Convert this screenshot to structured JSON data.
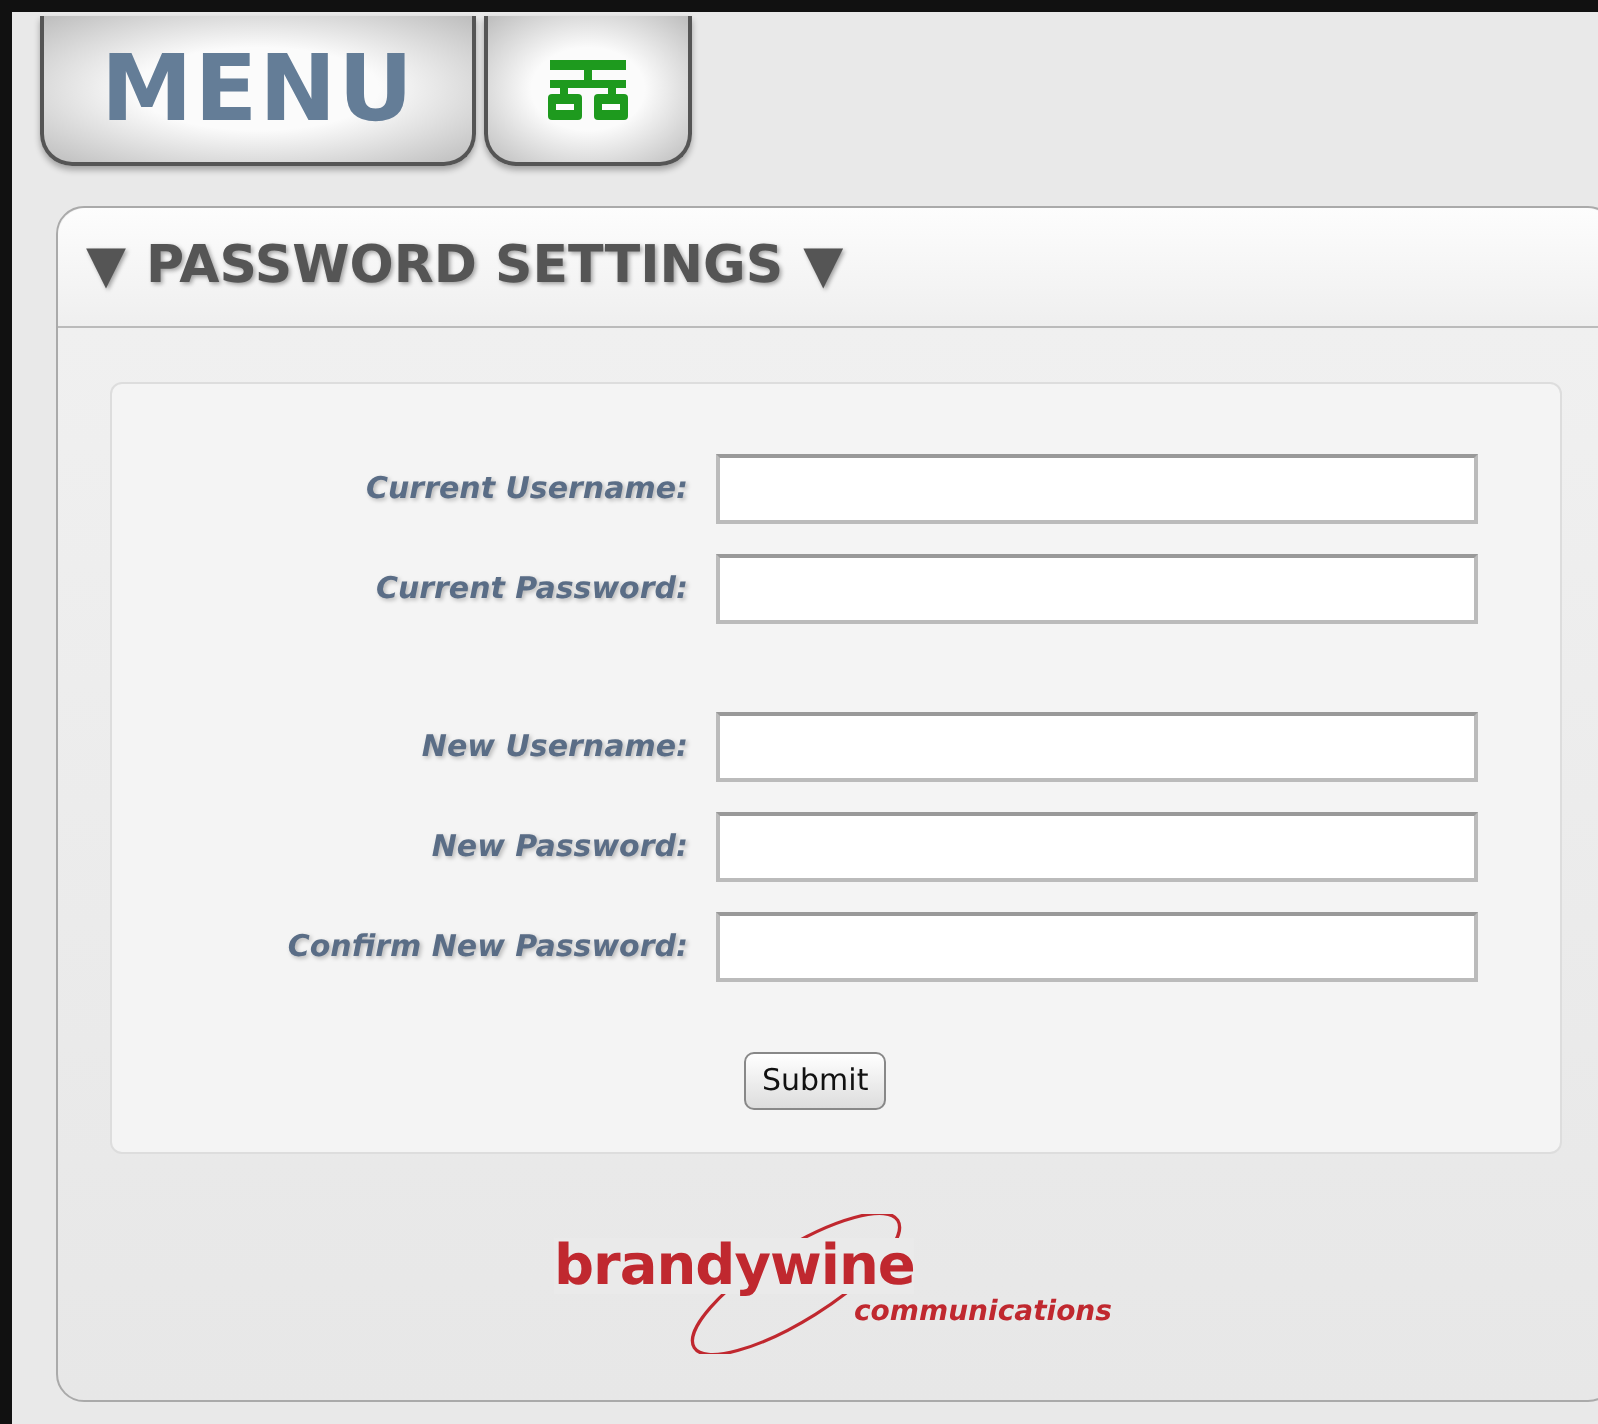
{
  "tabs": [
    {
      "kind": "text",
      "label": "MENU"
    },
    {
      "kind": "icon"
    }
  ],
  "panel": {
    "title_marker_left": "▼",
    "title": "PASSWORD SETTINGS",
    "title_marker_right": "▼"
  },
  "form": {
    "groups": [
      [
        {
          "label": "Current Username:"
        },
        {
          "label": "Current Password:"
        }
      ],
      [
        {
          "label": "New Username:"
        },
        {
          "label": "New Password:"
        },
        {
          "label": "Confirm New Password:"
        }
      ]
    ],
    "submit": "Submit"
  },
  "logo": {
    "name": "brandywine",
    "tagline": "communications"
  }
}
